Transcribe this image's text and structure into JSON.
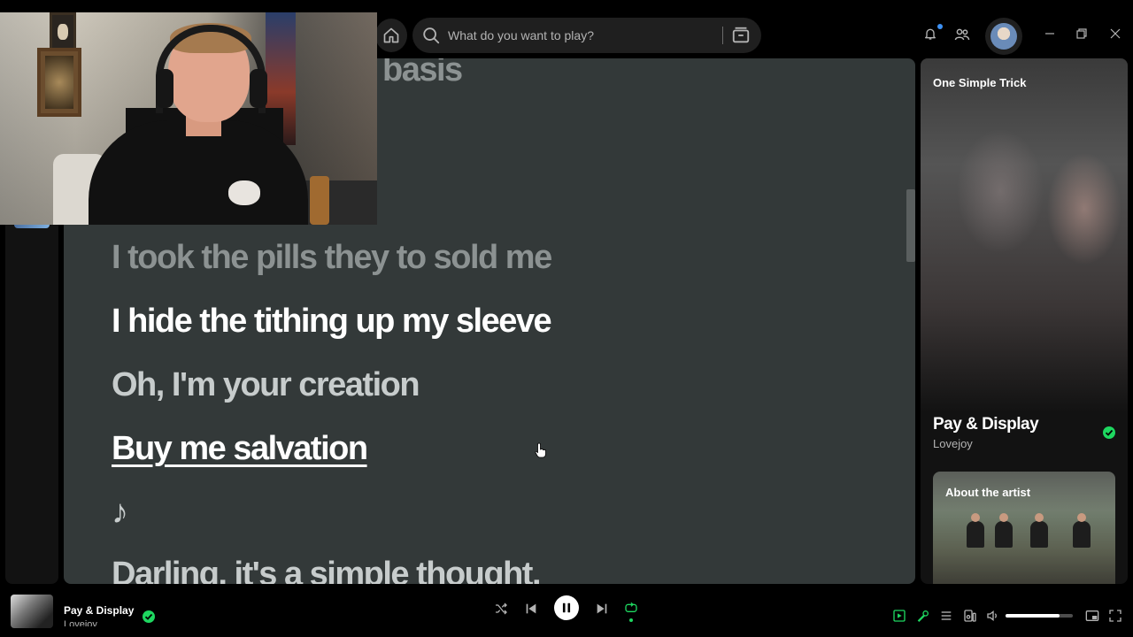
{
  "search": {
    "placeholder": "What do you want to play?"
  },
  "lyrics": {
    "lines": [
      {
        "text": "basis",
        "state": "past"
      },
      {
        "text": "I took the pills they to sold me",
        "state": "past"
      },
      {
        "text": "I hide the tithing up my sleeve",
        "state": "active"
      },
      {
        "text": "Oh, I'm your creation",
        "state": "future"
      },
      {
        "text": "Buy me salvation",
        "state": "hover"
      },
      {
        "text": "♪",
        "state": "future"
      },
      {
        "text": "Darling, it's a simple thought.",
        "state": "future"
      }
    ]
  },
  "now_playing_panel": {
    "playlist_title": "One Simple Trick",
    "track_title": "Pay & Display",
    "artist": "Lovejoy",
    "about_label": "About the artist"
  },
  "player": {
    "track_title": "Pay & Display",
    "artist": "Lovejoy",
    "volume": 0.8
  },
  "colors": {
    "accent": "#1ed760",
    "lyrics_bg": "#333939",
    "panel_bg": "#121212"
  }
}
